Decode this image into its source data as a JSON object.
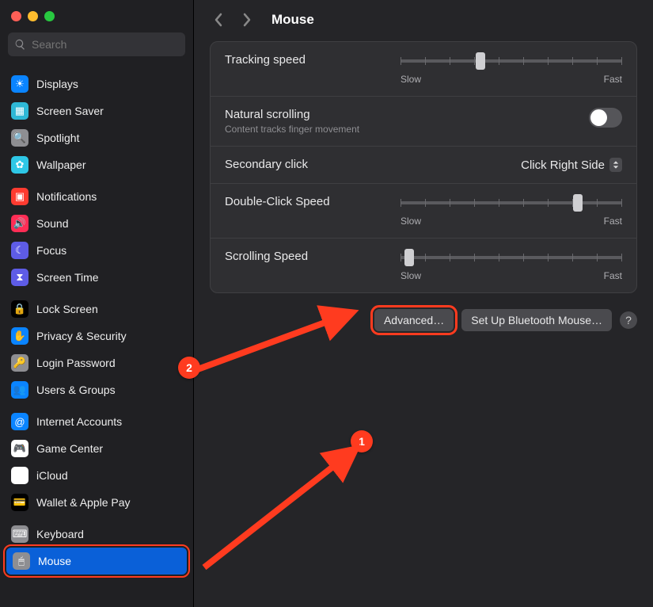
{
  "search": {
    "placeholder": "Search"
  },
  "sidebar": {
    "items": [
      {
        "label": "Displays",
        "icon_bg": "#0a84ff",
        "glyph": "☀"
      },
      {
        "label": "Screen Saver",
        "icon_bg": "#2eb8d6",
        "glyph": "▦"
      },
      {
        "label": "Spotlight",
        "icon_bg": "#8e8e92",
        "glyph": "🔍"
      },
      {
        "label": "Wallpaper",
        "icon_bg": "#2ec7e6",
        "glyph": "✿"
      },
      {
        "label": "Notifications",
        "icon_bg": "#ff3b30",
        "glyph": "▣"
      },
      {
        "label": "Sound",
        "icon_bg": "#ff2d55",
        "glyph": "🔊"
      },
      {
        "label": "Focus",
        "icon_bg": "#5e5ce6",
        "glyph": "☾"
      },
      {
        "label": "Screen Time",
        "icon_bg": "#5e5ce6",
        "glyph": "⧗"
      },
      {
        "label": "Lock Screen",
        "icon_bg": "#000000",
        "glyph": "🔒"
      },
      {
        "label": "Privacy & Security",
        "icon_bg": "#0a84ff",
        "glyph": "✋"
      },
      {
        "label": "Login Password",
        "icon_bg": "#8e8e92",
        "glyph": "🔑"
      },
      {
        "label": "Users & Groups",
        "icon_bg": "#0a84ff",
        "glyph": "👥"
      },
      {
        "label": "Internet Accounts",
        "icon_bg": "#0a84ff",
        "glyph": "@"
      },
      {
        "label": "Game Center",
        "icon_bg": "#ffffff",
        "glyph": "🎮"
      },
      {
        "label": "iCloud",
        "icon_bg": "#ffffff",
        "glyph": "☁"
      },
      {
        "label": "Wallet & Apple Pay",
        "icon_bg": "#000000",
        "glyph": "💳"
      },
      {
        "label": "Keyboard",
        "icon_bg": "#8e8e92",
        "glyph": "⌨"
      },
      {
        "label": "Mouse",
        "icon_bg": "#8e8e92",
        "glyph": "🖱"
      }
    ],
    "selected_index": 17,
    "groups": [
      [
        0,
        1,
        2,
        3
      ],
      [
        4,
        5,
        6,
        7
      ],
      [
        8,
        9,
        10,
        11
      ],
      [
        12,
        13,
        14,
        15
      ],
      [
        16,
        17
      ]
    ]
  },
  "header": {
    "title": "Mouse"
  },
  "settings": {
    "tracking": {
      "label": "Tracking speed",
      "min_label": "Slow",
      "max_label": "Fast",
      "value_pct": 36
    },
    "natural": {
      "label": "Natural scrolling",
      "sub": "Content tracks finger movement",
      "on": false
    },
    "secondary": {
      "label": "Secondary click",
      "value": "Click Right Side"
    },
    "double": {
      "label": "Double-Click Speed",
      "min_label": "Slow",
      "max_label": "Fast",
      "value_pct": 80
    },
    "scroll": {
      "label": "Scrolling Speed",
      "min_label": "Slow",
      "max_label": "Fast",
      "value_pct": 4
    }
  },
  "actions": {
    "advanced": "Advanced…",
    "bluetooth": "Set Up Bluetooth Mouse…",
    "help": "?"
  },
  "annotations": {
    "badge1": "1",
    "badge2": "2"
  }
}
